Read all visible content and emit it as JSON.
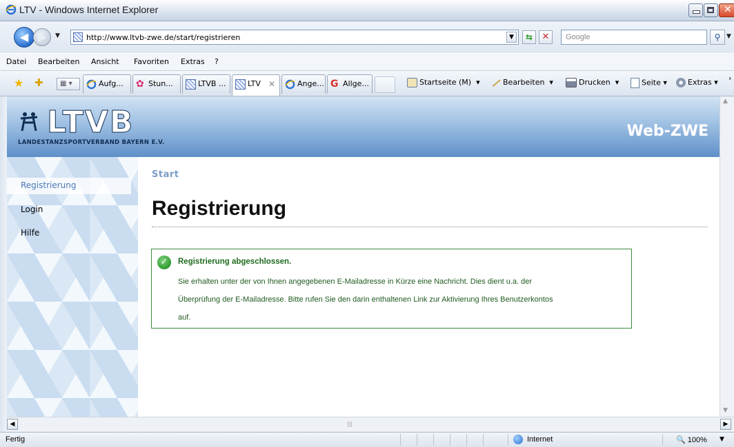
{
  "window": {
    "title": "LTV - Windows Internet Explorer"
  },
  "address": {
    "url": "http://www.ltvb-zwe.de/start/registrieren",
    "search_placeholder": "Google"
  },
  "menus": [
    "Datei",
    "Bearbeiten",
    "Ansicht",
    "Favoriten",
    "Extras",
    "?"
  ],
  "tabs": [
    {
      "label": "Aufg...",
      "icon": "ie-icon"
    },
    {
      "label": "Stun...",
      "icon": "flower-icon"
    },
    {
      "label": "LTVB ...",
      "icon": "bavaria-flag-icon"
    },
    {
      "label": "LTV",
      "icon": "bavaria-flag-icon",
      "active": true
    },
    {
      "label": "Ange...",
      "icon": "ie-icon"
    },
    {
      "label": "Allge...",
      "icon": "google-icon"
    }
  ],
  "toolbar": {
    "home_label": "Startseite (M)",
    "edit_label": "Bearbeiten",
    "print_label": "Drucken",
    "page_label": "Seite",
    "extras_label": "Extras"
  },
  "site": {
    "logo_text": "LTVB",
    "logo_subtitle": "LANDESTANZSPORTVERBAND BAYERN E.V.",
    "app_name": "Web-ZWE"
  },
  "sidebar": {
    "items": [
      {
        "label": "Registrierung",
        "active": true
      },
      {
        "label": "Login"
      },
      {
        "label": "Hilfe"
      }
    ]
  },
  "main": {
    "breadcrumb": "Start",
    "title": "Registrierung",
    "message": {
      "title": "Registrierung abgeschlossen.",
      "line1": "Sie erhalten unter der von Ihnen angegebenen E-Mailadresse in Kürze eine Nachricht. Dies dient u.a. der",
      "line2": "Überprüfung der E-Mailadresse. Bitte rufen Sie den darin enthaltenen Link zur Aktivierung Ihres Benutzerkontos",
      "line3": "auf."
    }
  },
  "status": {
    "text": "Fertig",
    "zone": "Internet",
    "zoom": "100%"
  },
  "colors": {
    "banner_dark": "#5f90c8",
    "success_border": "#3d8a3d",
    "breadcrumb": "#7a9cc6"
  }
}
